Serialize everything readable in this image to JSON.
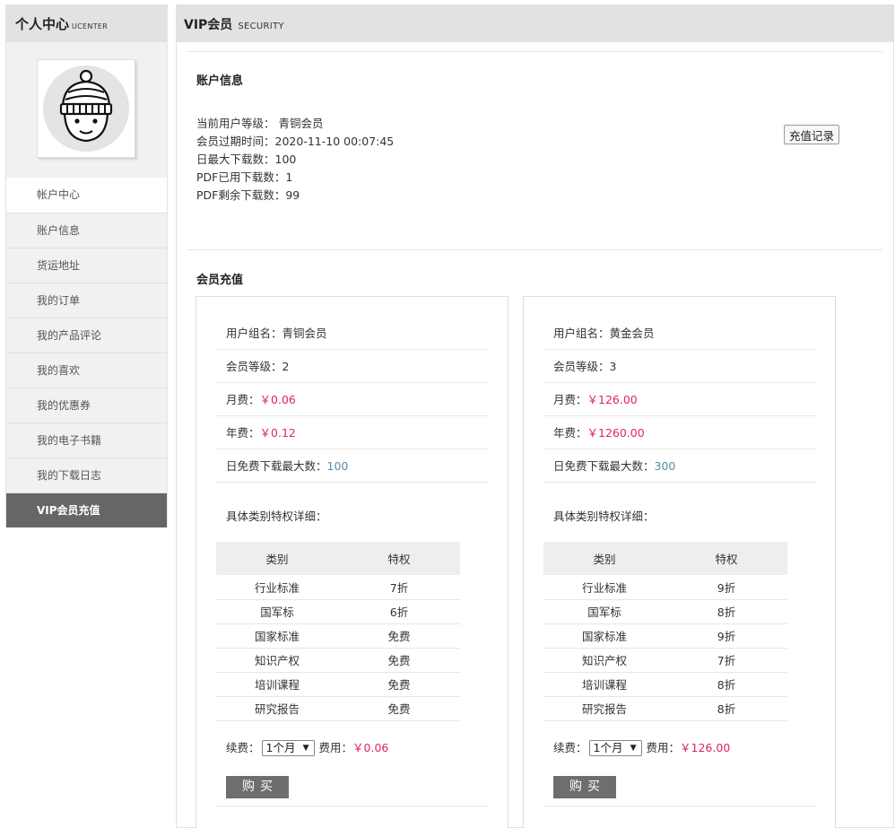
{
  "sidebar": {
    "title": "个人中心",
    "subtitle": "UCENTER",
    "items": [
      {
        "label": "帐户中心"
      },
      {
        "label": "账户信息"
      },
      {
        "label": "货运地址"
      },
      {
        "label": "我的订单"
      },
      {
        "label": "我的产品评论"
      },
      {
        "label": "我的喜欢"
      },
      {
        "label": "我的优惠券"
      },
      {
        "label": "我的电子书籍"
      },
      {
        "label": "我的下载日志"
      },
      {
        "label": "VIP会员充值"
      }
    ]
  },
  "main": {
    "title": "VIP会员",
    "subtitle": "SECURITY",
    "account": {
      "section_title": "账户信息",
      "lines": [
        "当前用户等级： 青铜会员",
        "会员过期时间：2020-11-10 00:07:45",
        "日最大下载数：100",
        "PDF已用下载数：1",
        "PDF剩余下载数：99"
      ],
      "recharge_button": "充值记录"
    },
    "recharge": {
      "section_title": "会员充值",
      "detail_title": "具体类别特权详细：",
      "table_headers": [
        "类别",
        "特权"
      ],
      "renew_label": "续费：",
      "fee_label": "费用：",
      "buy_label": "购买",
      "plans": [
        {
          "group_label": "用户组名：",
          "group": "青铜会员",
          "level_label": "会员等级：",
          "level": "2",
          "monthly_label": "月费：",
          "monthly": "￥0.06",
          "yearly_label": "年费：",
          "yearly": "￥0.12",
          "daily_label": "日免费下载最大数：",
          "daily": "100",
          "privileges": [
            [
              "行业标准",
              "7折"
            ],
            [
              "国军标",
              "6折"
            ],
            [
              "国家标准",
              "免费"
            ],
            [
              "知识产权",
              "免费"
            ],
            [
              "培训课程",
              "免费"
            ],
            [
              "研究报告",
              "免费"
            ]
          ],
          "period": "1个月",
          "fee": "￥0.06"
        },
        {
          "group_label": "用户组名：",
          "group": "黄金会员",
          "level_label": "会员等级：",
          "level": "3",
          "monthly_label": "月费：",
          "monthly": "￥126.00",
          "yearly_label": "年费：",
          "yearly": "￥1260.00",
          "daily_label": "日免费下载最大数：",
          "daily": "300",
          "privileges": [
            [
              "行业标准",
              "9折"
            ],
            [
              "国军标",
              "8折"
            ],
            [
              "国家标准",
              "9折"
            ],
            [
              "知识产权",
              "7折"
            ],
            [
              "培训课程",
              "8折"
            ],
            [
              "研究报告",
              "8折"
            ]
          ],
          "period": "1个月",
          "fee": "￥126.00"
        }
      ]
    }
  },
  "colors": {
    "price": "#e0245e",
    "blue_value": "#5b8aa6",
    "active_menu": "#666666",
    "header_bg": "#e2e2e2"
  },
  "icons": {
    "avatar": "user-avatar-beanie-icon",
    "select_arrow": "dropdown-arrow-icon"
  }
}
